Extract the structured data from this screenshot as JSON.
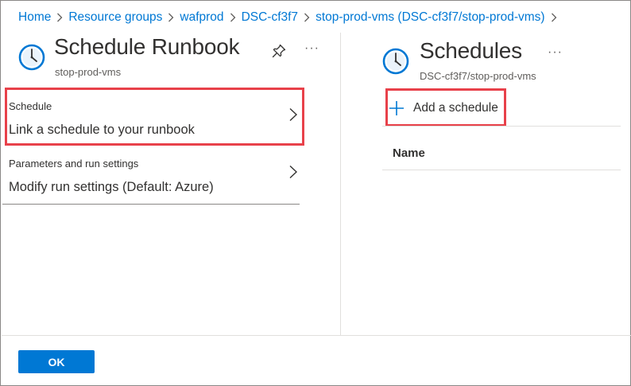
{
  "breadcrumb": [
    {
      "label": "Home"
    },
    {
      "label": "Resource groups"
    },
    {
      "label": "wafprod"
    },
    {
      "label": "DSC-cf3f7"
    },
    {
      "label": "stop-prod-vms (DSC-cf3f7/stop-prod-vms)"
    }
  ],
  "left_blade": {
    "title": "Schedule Runbook",
    "subtitle": "stop-prod-vms",
    "icon": "clock-icon",
    "pin_icon": "pin-icon",
    "more": "···",
    "settings": [
      {
        "category": "Schedule",
        "value": "Link a schedule to your runbook"
      },
      {
        "category": "Parameters and run settings",
        "value": "Modify run settings (Default: Azure)"
      }
    ]
  },
  "right_blade": {
    "title": "Schedules",
    "subtitle": "DSC-cf3f7/stop-prod-vms",
    "icon": "clock-icon",
    "more": "···",
    "add_label": "Add a schedule",
    "columns": [
      "Name"
    ]
  },
  "footer": {
    "ok_label": "OK"
  },
  "colors": {
    "accent": "#0078d4",
    "highlight": "#e8414a",
    "text": "#323130",
    "subtext": "#605e5c",
    "divider": "#e1dfdd"
  }
}
